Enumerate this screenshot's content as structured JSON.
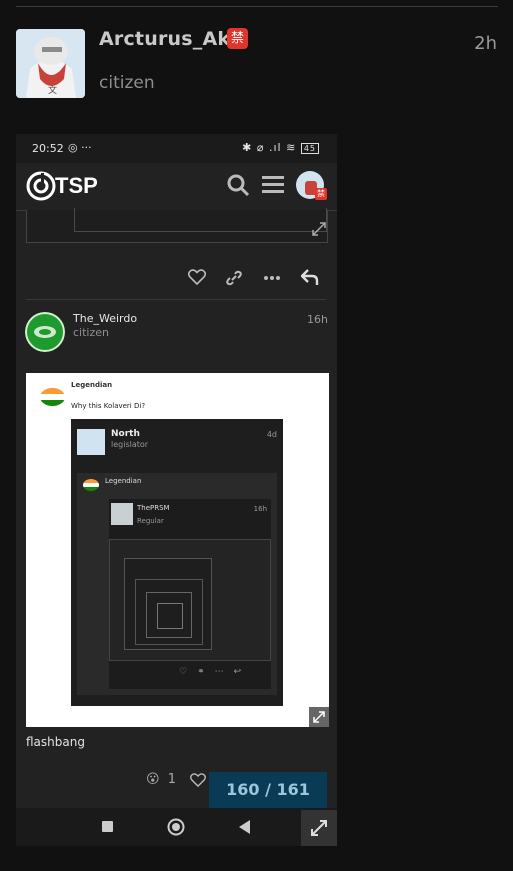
{
  "post": {
    "username": "Arcturus_Akh",
    "badge": "禁",
    "time": "2h",
    "role": "citizen"
  },
  "screenshot": {
    "status_time": "20:52",
    "status_icons": "✱ ⌀ .ıl ≋",
    "battery": "45",
    "logo_text": "TSP",
    "profile_badge": "禁",
    "post": {
      "username": "The_Weirdo",
      "role": "citizen",
      "time": "16h"
    },
    "inner": {
      "user1": "Legendian",
      "text1": "Why this Kolaveri Di?",
      "user2": "North",
      "role2": "legislator",
      "time2": "4d",
      "user3": "Legendian",
      "user4": "ThePRSM",
      "role4": "Regular",
      "time4": "16h"
    },
    "caption": "flashbang",
    "reaction_emoji": "😮",
    "reaction_count": "1",
    "progress": "160 / 161"
  },
  "colors": {
    "background": "#111111",
    "ban_badge": "#e0352b",
    "progress_bg": "#0a3b55"
  }
}
